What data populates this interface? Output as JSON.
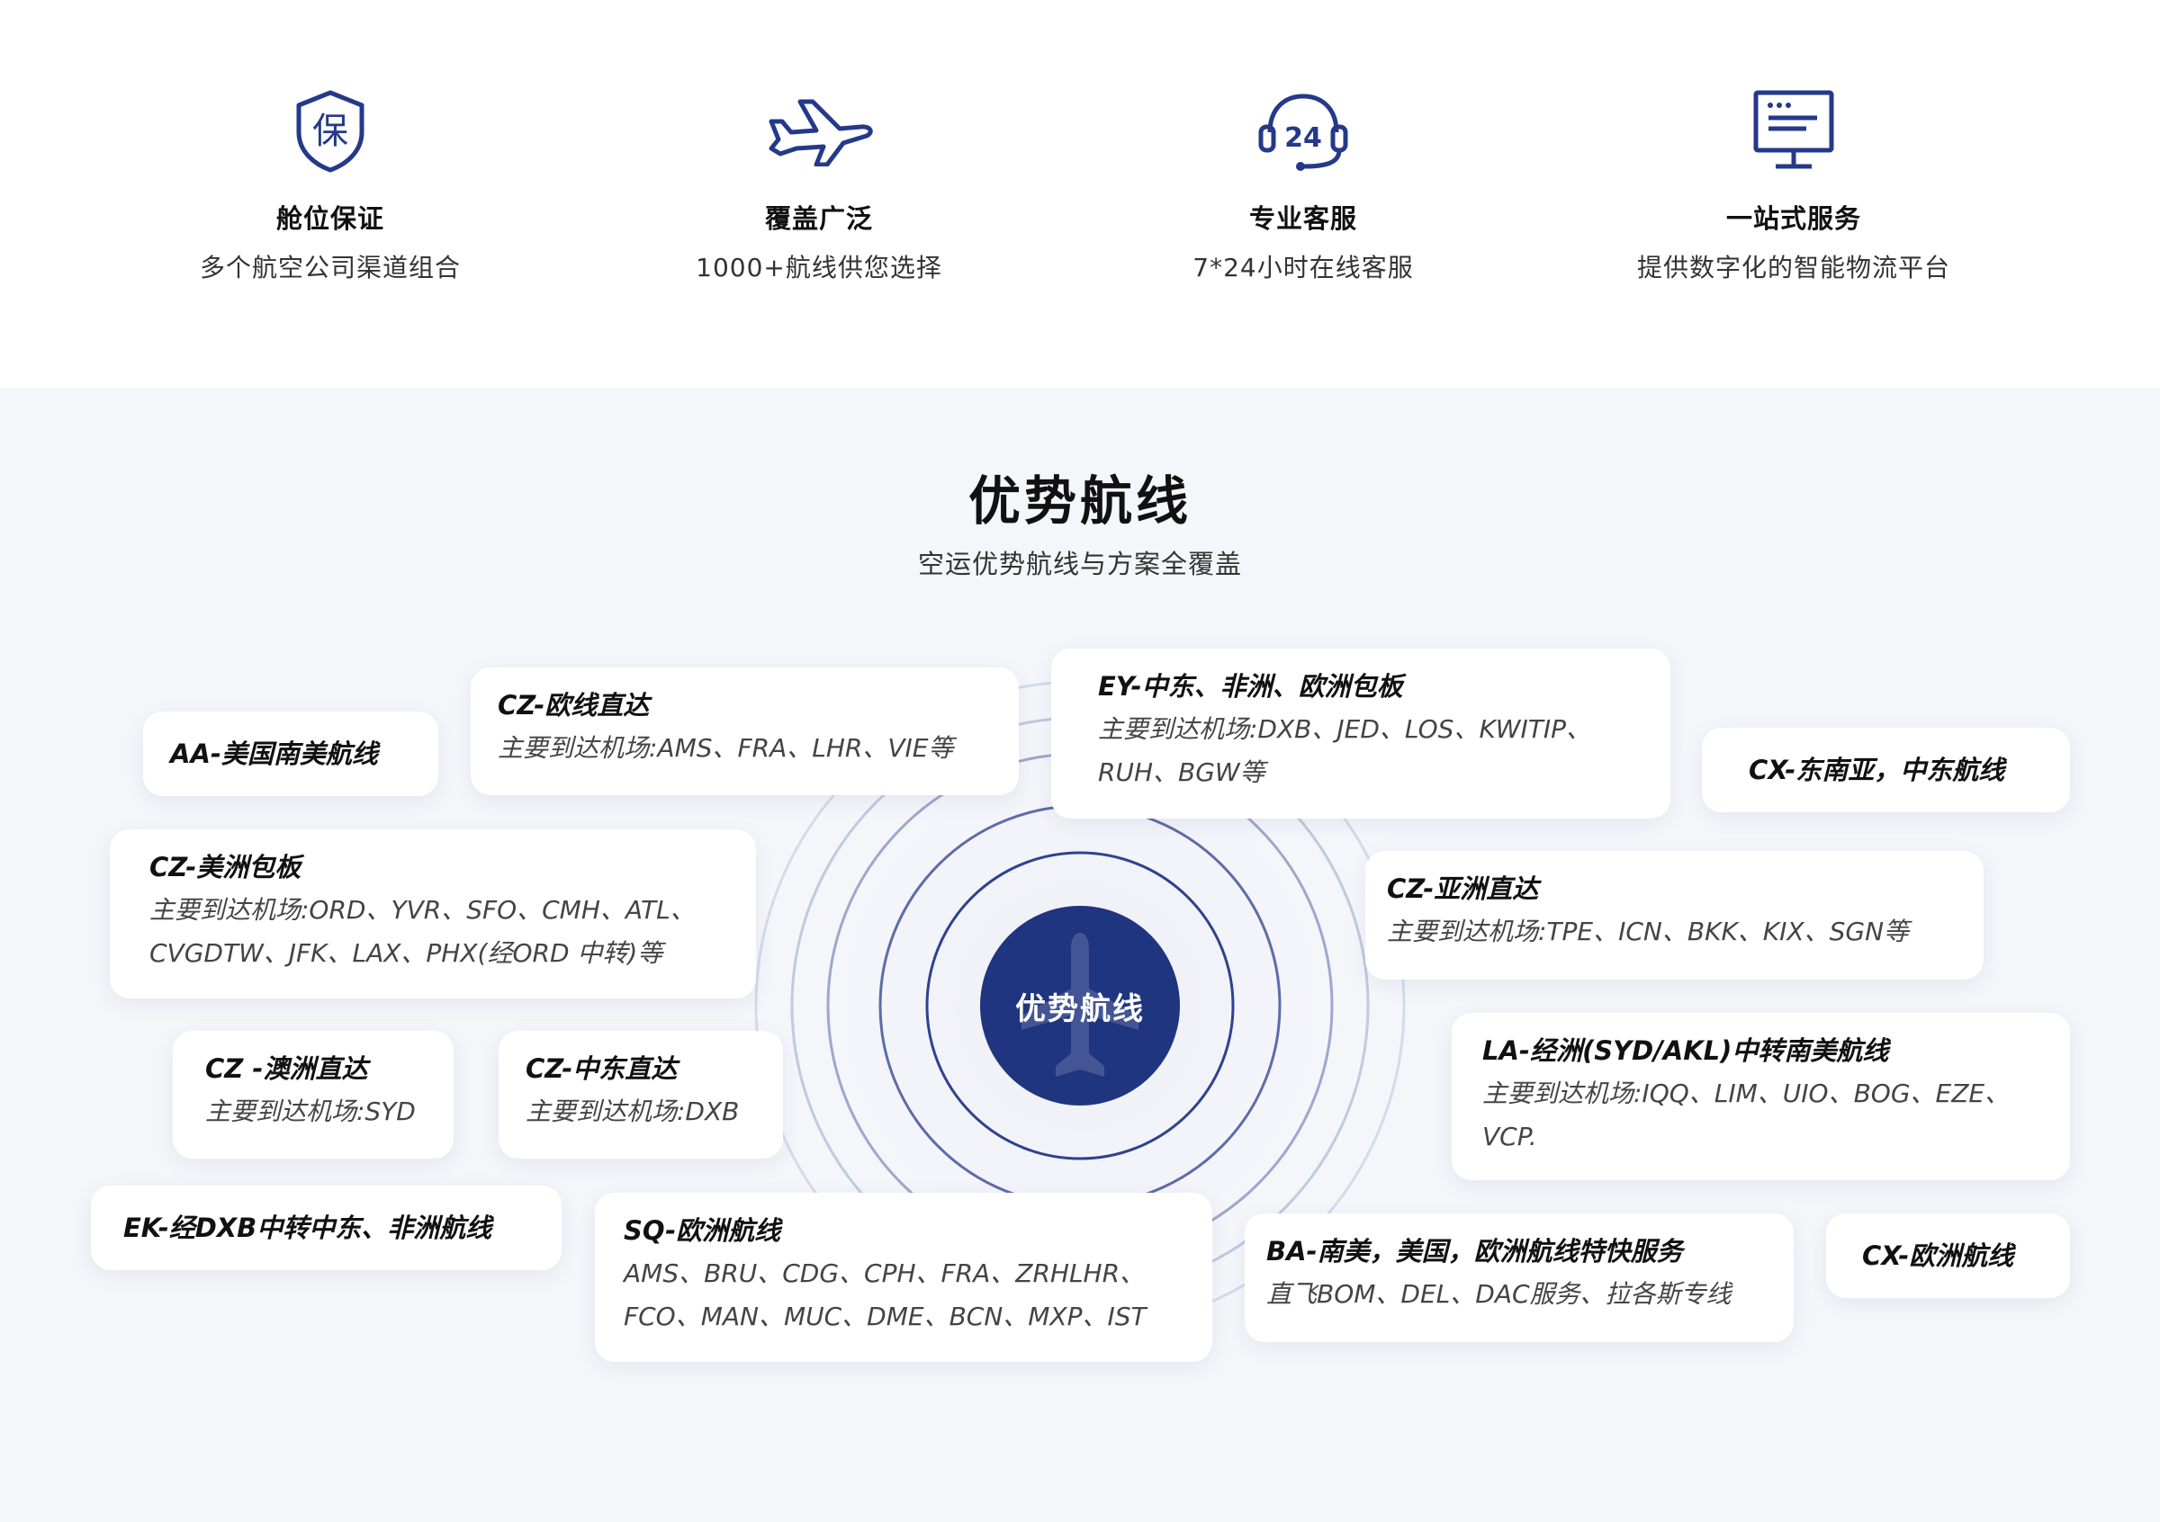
{
  "features": [
    {
      "icon": "shield-bao-icon",
      "glyph": "保",
      "title": "舱位保证",
      "desc": "多个航空公司渠道组合"
    },
    {
      "icon": "airplane-icon",
      "title": "覆盖广泛",
      "desc": "1000+航线供您选择"
    },
    {
      "icon": "headset-24-icon",
      "glyph": "24",
      "title": "专业客服",
      "desc": "7*24小时在线客服"
    },
    {
      "icon": "monitor-icon",
      "title": "一站式服务",
      "desc": "提供数字化的智能物流平台"
    }
  ],
  "section": {
    "title": "优势航线",
    "subtitle": "空运优势航线与方案全覆盖",
    "hub_label": "优势航线"
  },
  "routes": [
    {
      "title": "AA-美国南美航线"
    },
    {
      "title": "CZ-欧线直达",
      "desc": "主要到达机场:AMS、FRA、LHR、VIE等"
    },
    {
      "title": "EY-中东、非洲、欧洲包板",
      "desc": "主要到达机场:DXB、JED、LOS、KWITIP、RUH、BGW等"
    },
    {
      "title": "CX-东南亚，中东航线"
    },
    {
      "title": "CZ-美洲包板",
      "desc": "主要到达机场:ORD、YVR、SFO、CMH、ATL、CVGDTW、JFK、LAX、PHX(经ORD 中转)等"
    },
    {
      "title": "CZ-亚洲直达",
      "desc": "主要到达机场:TPE、ICN、BKK、KIX、SGN等"
    },
    {
      "title": "CZ -澳洲直达",
      "desc": "主要到达机场:SYD"
    },
    {
      "title": "CZ-中东直达",
      "desc": "主要到达机场:DXB"
    },
    {
      "title": "LA-经洲(SYD/AKL)中转南美航线",
      "desc": "主要到达机场:IQQ、LIM、UIO、BOG、EZE、VCP."
    },
    {
      "title": "EK-经DXB中转中东、非洲航线"
    },
    {
      "title": "SQ-欧洲航线",
      "desc": "AMS、BRU、CDG、CPH、FRA、ZRHLHR、FCO、MAN、MUC、DME、BCN、MXP、IST"
    },
    {
      "title": "BA-南美，美国，欧洲航线特快服务",
      "desc": "直飞BOM、DEL、DAC服务、拉各斯专线"
    },
    {
      "title": "CX-欧洲航线"
    }
  ],
  "colors": {
    "brand": "#1f3580",
    "ring": "#2b3d8f",
    "background": "#f5f6fa"
  }
}
